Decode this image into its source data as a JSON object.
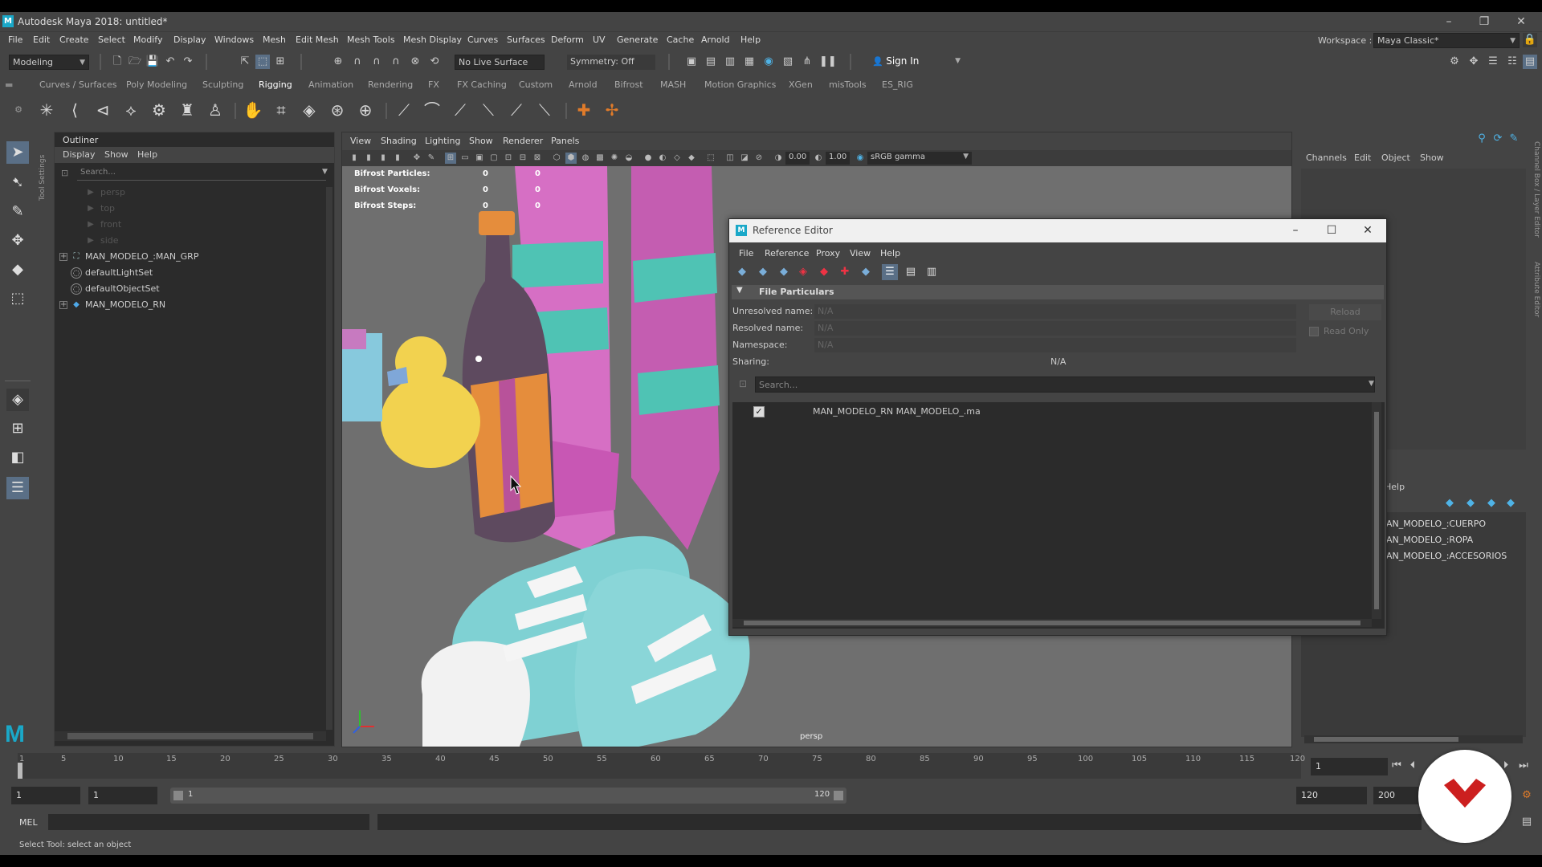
{
  "app": {
    "title": "Autodesk Maya 2018: untitled*",
    "menus": [
      "File",
      "Edit",
      "Create",
      "Select",
      "Modify",
      "Display",
      "Windows",
      "Mesh",
      "Edit Mesh",
      "Mesh Tools",
      "Mesh Display",
      "Curves",
      "Surfaces",
      "Deform",
      "UV",
      "Generate",
      "Cache",
      "Arnold",
      "Help"
    ],
    "workspace_label": "Workspace :",
    "workspace_value": "Maya Classic*"
  },
  "statusline": {
    "mode": "Modeling",
    "live_surface": "No Live Surface",
    "symmetry": "Symmetry: Off",
    "sign_in": "Sign In"
  },
  "shelf": {
    "tabs": [
      "Curves / Surfaces",
      "Poly Modeling",
      "Sculpting",
      "Rigging",
      "Animation",
      "Rendering",
      "FX",
      "FX Caching",
      "Custom",
      "Arnold",
      "Bifrost",
      "MASH",
      "Motion Graphics",
      "XGen",
      "misTools",
      "ES_RIG"
    ],
    "active_tab": "Rigging"
  },
  "toolbox": {
    "tool_settings_label": "Tool Settings"
  },
  "outliner": {
    "title": "Outliner",
    "menu": [
      "Display",
      "Show",
      "Help"
    ],
    "search_placeholder": "Search...",
    "items": [
      {
        "label": "persp",
        "icon": "camera-icon",
        "dim": true,
        "expand": false
      },
      {
        "label": "top",
        "icon": "camera-icon",
        "dim": true,
        "expand": false
      },
      {
        "label": "front",
        "icon": "camera-icon",
        "dim": true,
        "expand": false
      },
      {
        "label": "side",
        "icon": "camera-icon",
        "dim": true,
        "expand": false
      },
      {
        "label": "MAN_MODELO_:MAN_GRP",
        "icon": "group-icon",
        "dim": false,
        "expand": true
      },
      {
        "label": "defaultLightSet",
        "icon": "set-icon",
        "dim": false,
        "expand": false
      },
      {
        "label": "defaultObjectSet",
        "icon": "set-icon",
        "dim": false,
        "expand": false
      },
      {
        "label": "MAN_MODELO_RN",
        "icon": "reference-node-icon",
        "dim": false,
        "expand": true
      }
    ]
  },
  "viewport": {
    "menu": [
      "View",
      "Shading",
      "Lighting",
      "Show",
      "Renderer",
      "Panels"
    ],
    "exposure": "0.00",
    "gamma": "1.00",
    "color_space": "sRGB gamma",
    "hud": [
      {
        "label": "Bifrost Particles:",
        "v1": "0",
        "v2": "0"
      },
      {
        "label": "Bifrost Voxels:",
        "v1": "0",
        "v2": "0"
      },
      {
        "label": "Bifrost Steps:",
        "v1": "0",
        "v2": "0"
      }
    ],
    "camera_label": "persp"
  },
  "reference_editor": {
    "title": "Reference Editor",
    "menu": [
      "File",
      "Reference",
      "Proxy",
      "View",
      "Help"
    ],
    "section": "File Particulars",
    "fields": [
      {
        "label": "Unresolved name:",
        "value": "N/A"
      },
      {
        "label": "Resolved name:",
        "value": "N/A"
      },
      {
        "label": "Namespace:",
        "value": "N/A"
      }
    ],
    "sharing_label": "Sharing:",
    "sharing_value": "N/A",
    "reload": "Reload",
    "read_only": "Read Only",
    "search_placeholder": "Search...",
    "references": [
      {
        "checked": true,
        "label": "MAN_MODELO_RN MAN_MODELO_.ma"
      }
    ]
  },
  "channel_box": {
    "menu": [
      "Channels",
      "Edit",
      "Object",
      "Show"
    ],
    "layer_help": "Help",
    "layers": [
      "AN_MODELO_:CUERPO",
      "AN_MODELO_:ROPA",
      "AN_MODELO_:ACCESORIOS"
    ],
    "side_tabs": [
      "Channel Box / Layer Editor",
      "Attribute Editor"
    ]
  },
  "timeline": {
    "ticks": [
      "1",
      "5",
      "10",
      "15",
      "20",
      "25",
      "30",
      "35",
      "40",
      "45",
      "50",
      "55",
      "60",
      "65",
      "70",
      "75",
      "80",
      "85",
      "90",
      "95",
      "100",
      "105",
      "110",
      "115",
      "120"
    ],
    "current_frame": "1",
    "start": "1",
    "range_start": "1",
    "range_slider_start": "1",
    "range_slider_end": "120",
    "range_end": "120",
    "end": "200"
  },
  "command_line": {
    "lang": "MEL"
  },
  "help_line": "Select Tool: select an object",
  "colors": {
    "ui_bg": "#444444",
    "panel_dark": "#2b2b2b",
    "viewport_bg": "#6f6f6f",
    "accent_blue": "#5a6f86",
    "maya_logo": "#1aa8c8",
    "watermark_red": "#cc1f1f"
  }
}
